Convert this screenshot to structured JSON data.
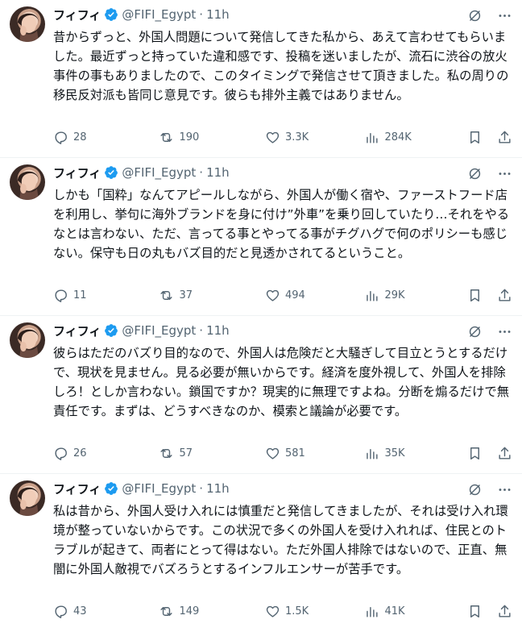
{
  "tweets": [
    {
      "author": "フィフィ",
      "handle": "@FIFI_Egypt",
      "dot": "·",
      "time": "11h",
      "text": "昔からずっと、外国人問題について発信してきた私から、あえて言わせてもらいました。最近ずっと持っていた違和感です、投稿を迷いましたが、流石に渋谷の放火事件の事もありましたので、このタイミングで発信させて頂きました。私の周りの移民反対派も皆同じ意見です。彼らも排外主義ではありません。",
      "replies": "28",
      "reposts": "190",
      "likes": "3.3K",
      "views": "284K"
    },
    {
      "author": "フィフィ",
      "handle": "@FIFI_Egypt",
      "dot": "·",
      "time": "11h",
      "text": "しかも「国粋」なんてアピールしながら、外国人が働く宿や、ファーストフード店を利用し、挙句に海外ブランドを身に付け”外車”を乗り回していたり…それをやるなとは言わない、ただ、言ってる事とやってる事がチグハグで何のポリシーも感じない。保守も日の丸もバズ目的だと見透かされてるということ。",
      "replies": "11",
      "reposts": "37",
      "likes": "494",
      "views": "29K"
    },
    {
      "author": "フィフィ",
      "handle": "@FIFI_Egypt",
      "dot": "·",
      "time": "11h",
      "text": "彼らはただのバズり目的なので、外国人は危険だと大騒ぎして目立とうとするだけで、現状を見ません。見る必要が無いからです。経済を度外視して、外国人を排除しろ！としか言わない。鎖国ですか？現実的に無理ですよね。分断を煽るだけで無責任です。まずは、どうすべきなのか、模索と議論が必要です。",
      "replies": "26",
      "reposts": "57",
      "likes": "581",
      "views": "35K"
    },
    {
      "author": "フィフィ",
      "handle": "@FIFI_Egypt",
      "dot": "·",
      "time": "11h",
      "text": "私は昔から、外国人受け入れには慎重だと発信してきましたが、それは受け入れ環境が整っていないからです。この状況で多くの外国人を受け入れれば、住民とのトラブルが起きて、両者にとって得はない。ただ外国人排除ではないので、正直、無闇に外国人敵視でバズろうとするインフルエンサーが苦手です。",
      "replies": "43",
      "reposts": "149",
      "likes": "1.5K",
      "views": "41K"
    }
  ],
  "icons": {
    "verified": "verified-badge-icon",
    "grok": "grok-icon",
    "more": "more-dots-icon",
    "reply": "reply-icon",
    "repost": "repost-icon",
    "like": "heart-icon",
    "views": "views-chart-icon",
    "bookmark": "bookmark-icon",
    "share": "share-icon"
  },
  "colors": {
    "verified": "#1d9bf0",
    "secondary_text": "#536471",
    "primary_text": "#0f1419",
    "divider": "#eff3f4"
  }
}
